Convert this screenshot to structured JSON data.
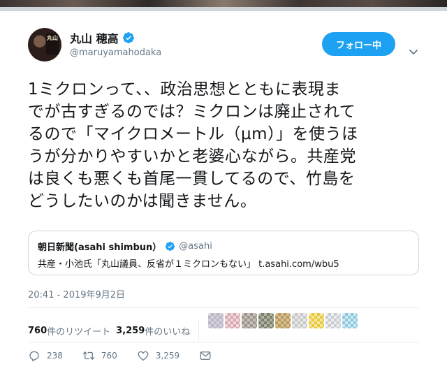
{
  "author": {
    "name": "丸山 穂高",
    "handle": "@maruyamahodaka",
    "avatar_sign": "丸山"
  },
  "follow_button": {
    "label": "フォロー中"
  },
  "tweet": {
    "lines": [
      "1ミクロンって、、政治思想とともに表現ま",
      "でが古すぎるのでは？ミクロンは廃止されて",
      "るので「マイクロメートル（μm）」を使うほ",
      "うが分かりやすいかと老婆心ながら。共産党",
      "は良くも悪くも首尾一貫してるので、竹島を",
      "どうしたいのかは聞きません。"
    ]
  },
  "quote": {
    "name": "朝日新聞(asahi shimbun）",
    "handle": "@asahi",
    "text": "共産・小池氏「丸山議員、反省が１ミクロンもない」 t.asahi.com/wbu5"
  },
  "timestamp": "20:41 - 2019年9月2日",
  "stats": {
    "retweets_num": "760",
    "retweets_label": "件のリツイート",
    "likes_num": "3,259",
    "likes_label": "件のいいね"
  },
  "actions": {
    "reply_count": "238",
    "retweet_count": "760",
    "like_count": "3,259"
  },
  "colors": {
    "accent": "#1da1f2",
    "secondary_text": "#657786",
    "border": "#ccd6dd"
  },
  "icons": [
    "verified-icon",
    "chevron-down-icon",
    "reply-icon",
    "retweet-icon",
    "heart-icon",
    "envelope-icon"
  ]
}
